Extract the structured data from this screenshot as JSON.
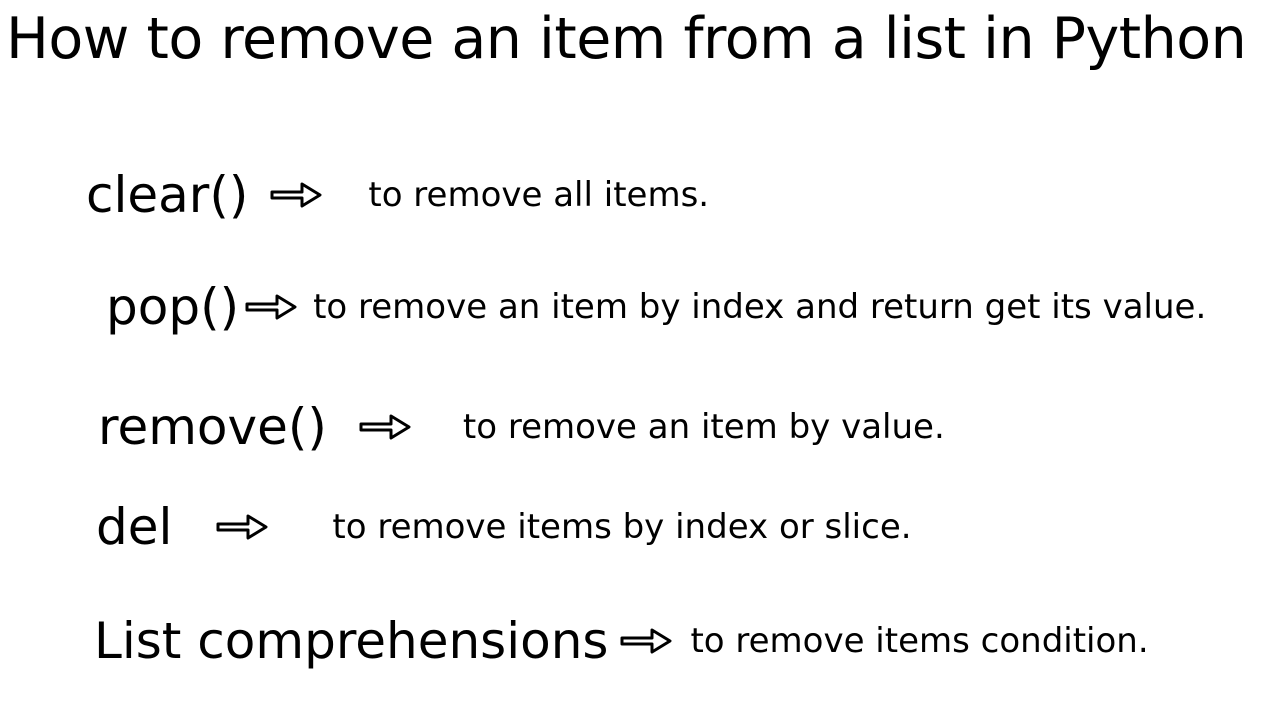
{
  "title": "How to remove an item from a list in Python",
  "rows": [
    {
      "method": "clear()",
      "desc": "to remove all items."
    },
    {
      "method": "pop()",
      "desc": "to remove an item by index and return get its value."
    },
    {
      "method": "remove()",
      "desc": "to remove an item by value."
    },
    {
      "method": "del",
      "desc": "to remove items by index or slice."
    },
    {
      "method": "List comprehensions",
      "desc": "to remove items condition."
    }
  ]
}
